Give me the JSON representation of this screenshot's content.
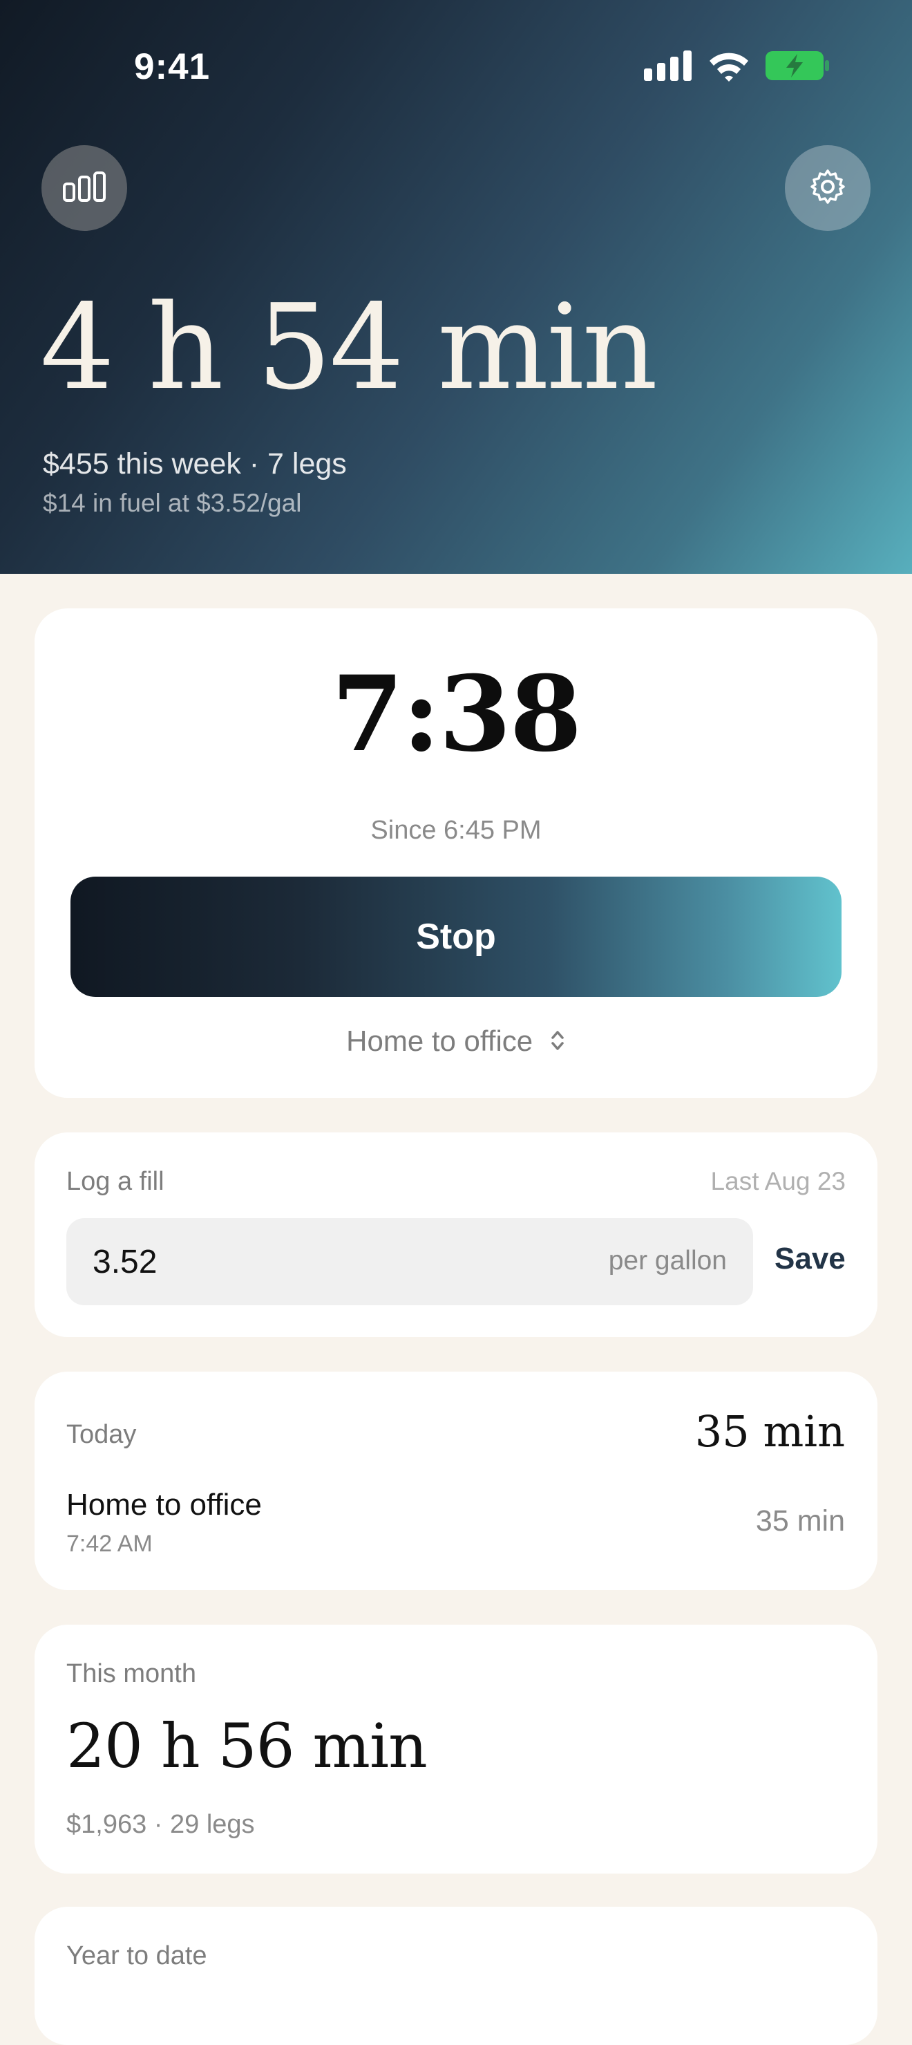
{
  "status_bar": {
    "time": "9:41"
  },
  "header": {
    "total_time": "4 h 54 min",
    "week_summary": "$455 this week · 7 legs",
    "fuel_summary": "$14 in fuel at $3.52/gal",
    "stats_icon": "bar-chart-icon",
    "settings_icon": "gear-icon"
  },
  "timer": {
    "elapsed": "7:38",
    "since": "Since 6:45 PM",
    "stop_label": "Stop",
    "route": "Home to office",
    "route_icon": "chevron-up-down-icon"
  },
  "fill": {
    "label": "Log a fill",
    "last": "Last Aug 23",
    "value": "3.52",
    "unit": "per gallon",
    "save_label": "Save"
  },
  "today": {
    "label": "Today",
    "total": "35 min",
    "entries": [
      {
        "route": "Home to office",
        "time": "7:42 AM",
        "duration": "35 min"
      }
    ]
  },
  "month": {
    "label": "This month",
    "total": "20 h 56 min",
    "summary": "$1,963 · 29 legs"
  },
  "ytd": {
    "label": "Year to date"
  },
  "colors": {
    "background": "#f8f3ec",
    "header_dark": "#111a25",
    "header_teal": "#58afbd",
    "accent_text": "#223447",
    "battery": "#34c759"
  }
}
